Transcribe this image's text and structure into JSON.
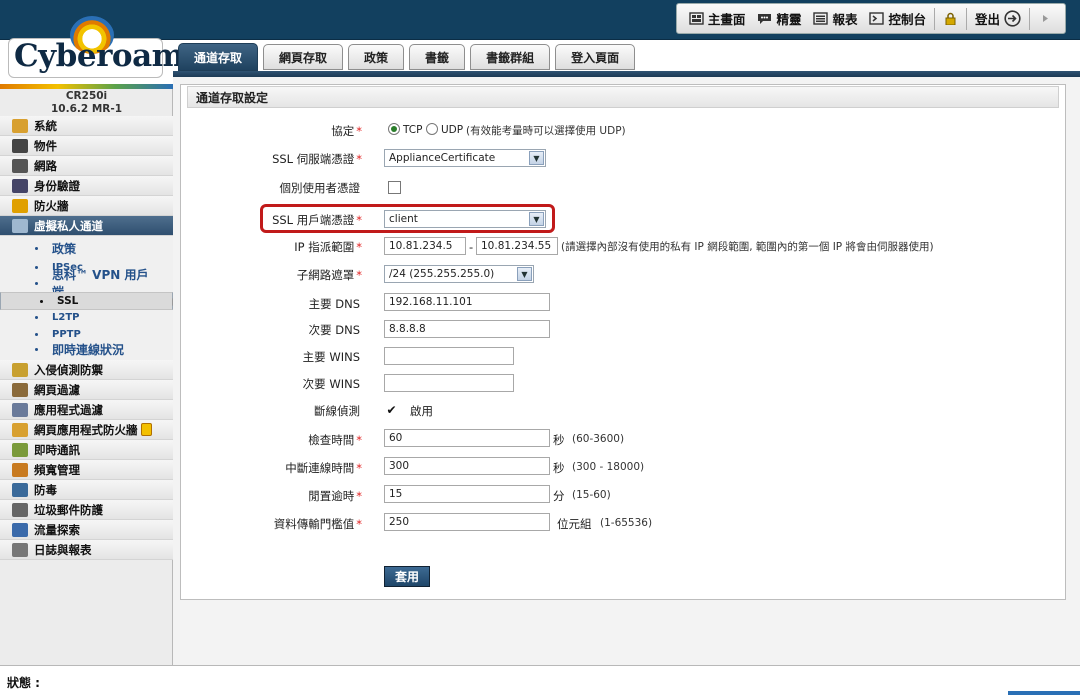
{
  "brand": {
    "logo_text": "Cyberoam",
    "model": "CR250i",
    "version": "10.6.2 MR-1"
  },
  "toplinks": [
    {
      "label": "主畫面",
      "icon": "home-icon"
    },
    {
      "label": "精靈",
      "icon": "wizard-icon"
    },
    {
      "label": "報表",
      "icon": "report-icon"
    },
    {
      "label": "控制台",
      "icon": "console-icon"
    },
    {
      "label": "",
      "icon": "lock-icon"
    },
    {
      "label": "登出",
      "icon": "logout-icon"
    },
    {
      "label": "",
      "icon": "play-icon"
    }
  ],
  "sidebar": {
    "items": [
      {
        "label": "系統",
        "icon": "system-icon",
        "color": "#d8a030"
      },
      {
        "label": "物件",
        "icon": "objects-icon",
        "color": "#444"
      },
      {
        "label": "網路",
        "icon": "network-icon",
        "color": "#555"
      },
      {
        "label": "身份驗證",
        "icon": "identity-icon",
        "color": "#446"
      },
      {
        "label": "防火牆",
        "icon": "firewall-icon",
        "color": "#e0a000"
      },
      {
        "label": "虛擬私人通道",
        "icon": "vpn-icon",
        "color": "#6a8aaa"
      }
    ],
    "vpn_sub": [
      {
        "label": "政策"
      },
      {
        "label": "IPSec"
      },
      {
        "label": "思科™ VPN 用戶端..."
      },
      {
        "label": "SSL"
      },
      {
        "label": "L2TP"
      },
      {
        "label": "PPTP"
      },
      {
        "label": "即時連線狀況"
      }
    ],
    "items2": [
      {
        "label": "入侵偵測防禦",
        "icon": "ips-icon",
        "color": "#c8a030"
      },
      {
        "label": "網頁過濾",
        "icon": "web-filter-icon",
        "color": "#8a6a3a"
      },
      {
        "label": "應用程式過濾",
        "icon": "app-filter-icon",
        "color": "#6a7a9a"
      },
      {
        "label": "網頁應用程式防火牆",
        "icon": "waf-icon",
        "color": "#d8a030"
      },
      {
        "label": "即時通訊",
        "icon": "im-icon",
        "color": "#7a9a3a"
      },
      {
        "label": "頻寬管理",
        "icon": "qos-icon",
        "color": "#c87a20"
      },
      {
        "label": "防毒",
        "icon": "antivirus-icon",
        "color": "#3a6a9a"
      },
      {
        "label": "垃圾郵件防護",
        "icon": "antispam-icon",
        "color": "#666"
      },
      {
        "label": "流量探索",
        "icon": "traffic-icon",
        "color": "#3a6aaa"
      },
      {
        "label": "日誌與報表",
        "icon": "logs-icon",
        "color": "#777"
      }
    ]
  },
  "tabs": [
    "通道存取",
    "網頁存取",
    "政策",
    "書籤",
    "書籤群組",
    "登入頁面"
  ],
  "panel": {
    "title": "通道存取設定"
  },
  "form": {
    "protocol": {
      "label": "協定",
      "opt1": "TCP",
      "opt2": "UDP",
      "hint": "(有效能考量時可以選擇使用 UDP)"
    },
    "ssl_server_cert": {
      "label": "SSL 伺服端憑證",
      "value": "ApplianceCertificate"
    },
    "per_user_cert": {
      "label": "個別使用者憑證"
    },
    "ssl_client_cert": {
      "label": "SSL 用戶端憑證",
      "value": "client"
    },
    "ip_range": {
      "label": "IP 指派範圍",
      "from": "10.81.234.5",
      "sep": "-",
      "to": "10.81.234.55",
      "hint": "(請選擇內部沒有使用的私有 IP 網段範圍, 範圍內的第一個 IP 將會由伺服器使用)"
    },
    "subnet_mask": {
      "label": "子網路遮罩",
      "value": "/24 (255.255.255.0)"
    },
    "primary_dns": {
      "label": "主要 DNS",
      "value": "192.168.11.101"
    },
    "secondary_dns": {
      "label": "次要 DNS",
      "value": "8.8.8.8"
    },
    "primary_wins": {
      "label": "主要 WINS",
      "value": ""
    },
    "secondary_wins": {
      "label": "次要 WINS",
      "value": ""
    },
    "dead_peer": {
      "label": "斷線偵測",
      "check_label": "啟用",
      "checked": "✔"
    },
    "check_interval": {
      "label": "檢查時間",
      "value": "60",
      "unit": "秒",
      "range": "(60-3600)"
    },
    "disconnect_time": {
      "label": "中斷連線時間",
      "value": "300",
      "unit": "秒",
      "range": "(300 - 18000)"
    },
    "idle_timeout": {
      "label": "閒置逾時",
      "value": "15",
      "unit": "分",
      "range": "(15-60)"
    },
    "threshold": {
      "label": "資料傳輸門檻值",
      "value": "250",
      "unit": "位元組",
      "range": "(1-65536)"
    }
  },
  "apply_label": "套用",
  "status_label": "狀態 :",
  "required_mark": "*"
}
